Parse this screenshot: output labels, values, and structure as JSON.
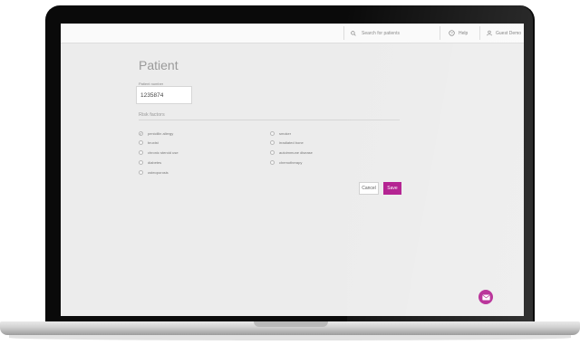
{
  "header": {
    "search_placeholder": "Search for patients",
    "help_label": "Help",
    "user_label": "Guest Demo"
  },
  "page": {
    "title": "Patient",
    "patient_number_label": "Patient number",
    "patient_number_value": "1235874",
    "risk_factors_title": "Risk factors"
  },
  "risk_factors": {
    "left": [
      {
        "label": "penicillin allergy",
        "checked": true
      },
      {
        "label": "bruxist",
        "checked": false
      },
      {
        "label": "chronic steroid use",
        "checked": false
      },
      {
        "label": "diabetes",
        "checked": false
      },
      {
        "label": "osteoporosis",
        "checked": false
      }
    ],
    "right": [
      {
        "label": "smoker",
        "checked": false
      },
      {
        "label": "irradiated bone",
        "checked": false
      },
      {
        "label": "autoimmune disease",
        "checked": false
      },
      {
        "label": "chemotherapy",
        "checked": false
      }
    ]
  },
  "actions": {
    "cancel_label": "Cancel",
    "save_label": "Save"
  },
  "colors": {
    "accent": "#b0188c",
    "background": "#ececec"
  },
  "icons": {
    "search": "search-icon",
    "help": "help-icon",
    "user": "user-icon",
    "message": "message-icon",
    "check": "check-icon"
  }
}
